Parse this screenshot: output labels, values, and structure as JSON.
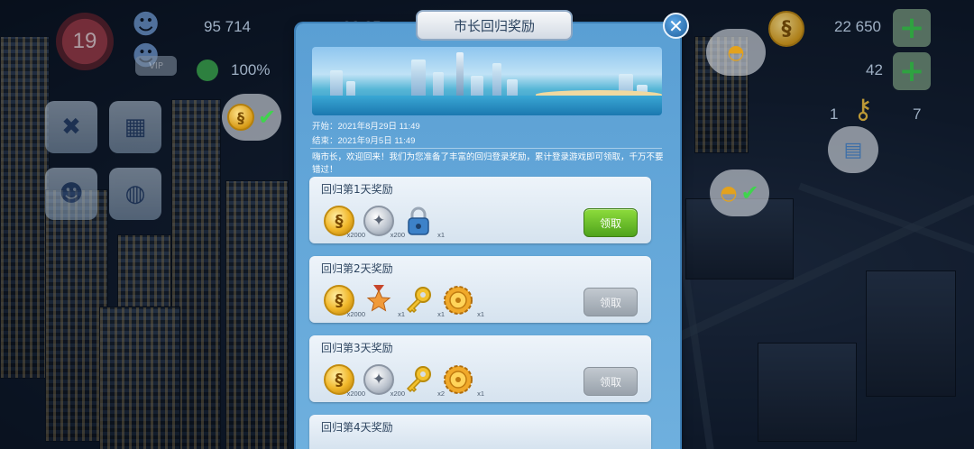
{
  "hud": {
    "level": "19",
    "population": "95 714",
    "population_partial": "92 25",
    "happiness": "100%",
    "simcash": "22 650",
    "golden_keys": "42",
    "keys_left": "1",
    "keys_right": "7"
  },
  "popup": {
    "title": "市长回归奖励",
    "start_date": "开始：2021年8月29日 11:49",
    "end_date": "结束：2021年9月5日 11:49",
    "intro": "嗨市长，欢迎回来！我们为您准备了丰富的回归登录奖励，累计登录游戏即可领取，千万不要错过！",
    "claim_label": "领取",
    "days": [
      {
        "title": "回归第1天奖励",
        "state": "active",
        "rewards": [
          {
            "icon": "simoleon-coin-icon",
            "qty": "x2000"
          },
          {
            "icon": "simcash-icon",
            "qty": "x200"
          },
          {
            "icon": "padlock-icon",
            "qty": "x1"
          }
        ]
      },
      {
        "title": "回归第2天奖励",
        "state": "disabled",
        "rewards": [
          {
            "icon": "simoleon-coin-icon",
            "qty": "x2000"
          },
          {
            "icon": "medal-icon",
            "qty": "x1"
          },
          {
            "icon": "golden-key-icon",
            "qty": "x1"
          },
          {
            "icon": "gear-token-icon",
            "qty": "x1"
          }
        ]
      },
      {
        "title": "回归第3天奖励",
        "state": "disabled",
        "rewards": [
          {
            "icon": "simoleon-coin-icon",
            "qty": "x2000"
          },
          {
            "icon": "simcash-icon",
            "qty": "x200"
          },
          {
            "icon": "golden-key-icon",
            "qty": "x2"
          },
          {
            "icon": "gear-token-icon",
            "qty": "x1"
          }
        ]
      },
      {
        "title": "回归第4天奖励",
        "state": "disabled",
        "rewards": []
      }
    ]
  },
  "colors": {
    "panel": "#6fb0de",
    "claim_active": "#5fb526",
    "claim_disabled": "#aab2bb"
  }
}
